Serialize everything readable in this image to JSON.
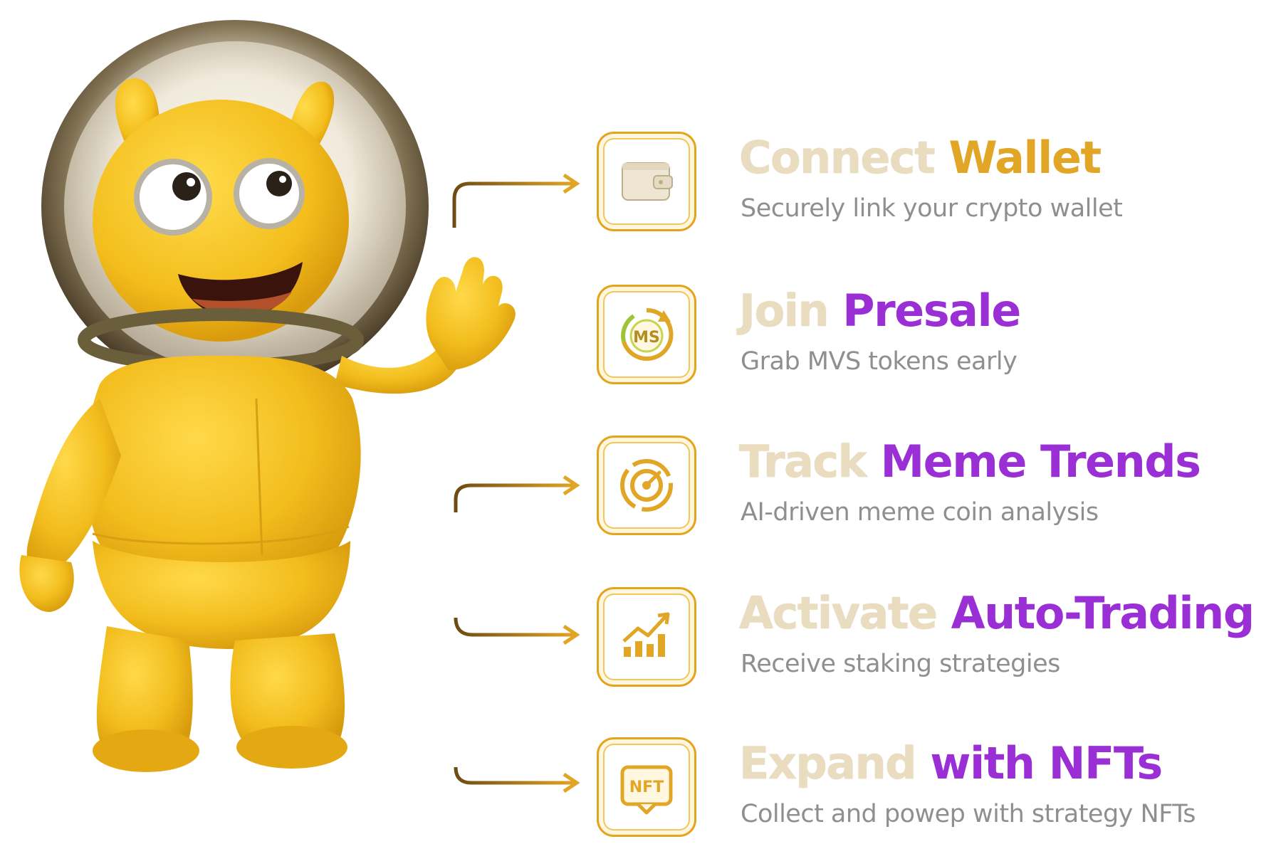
{
  "colors": {
    "gold": "#e2a626",
    "purple": "#9a2fd6",
    "title_light": "#e9dcbf",
    "subtitle_gray": "#8f8f8f",
    "mascot_yellow": "#f2bd1d"
  },
  "steps": [
    {
      "icon": "wallet-icon",
      "title_main": "Connect",
      "title_accent": "Wallet",
      "accent_color": "gold",
      "subtitle": "Securely link your crypto wallet"
    },
    {
      "icon": "mvs-token-icon",
      "title_main": "Join",
      "title_accent": "Presale",
      "accent_color": "purple",
      "subtitle": "Grab MVS tokens early",
      "icon_text": "MS"
    },
    {
      "icon": "target-icon",
      "title_main": "Track",
      "title_accent": "Meme Trends",
      "accent_color": "purple",
      "subtitle": "AI-driven meme coin analysis"
    },
    {
      "icon": "growth-chart-icon",
      "title_main": "Activate",
      "title_accent": "Auto-Trading",
      "accent_color": "purple",
      "subtitle": "Receive staking strategies"
    },
    {
      "icon": "nft-icon",
      "title_main": "Expand",
      "title_accent": "with NFTs",
      "accent_color": "purple",
      "subtitle": "Collect and powep with strategy NFTs",
      "icon_text": "NFT"
    }
  ]
}
